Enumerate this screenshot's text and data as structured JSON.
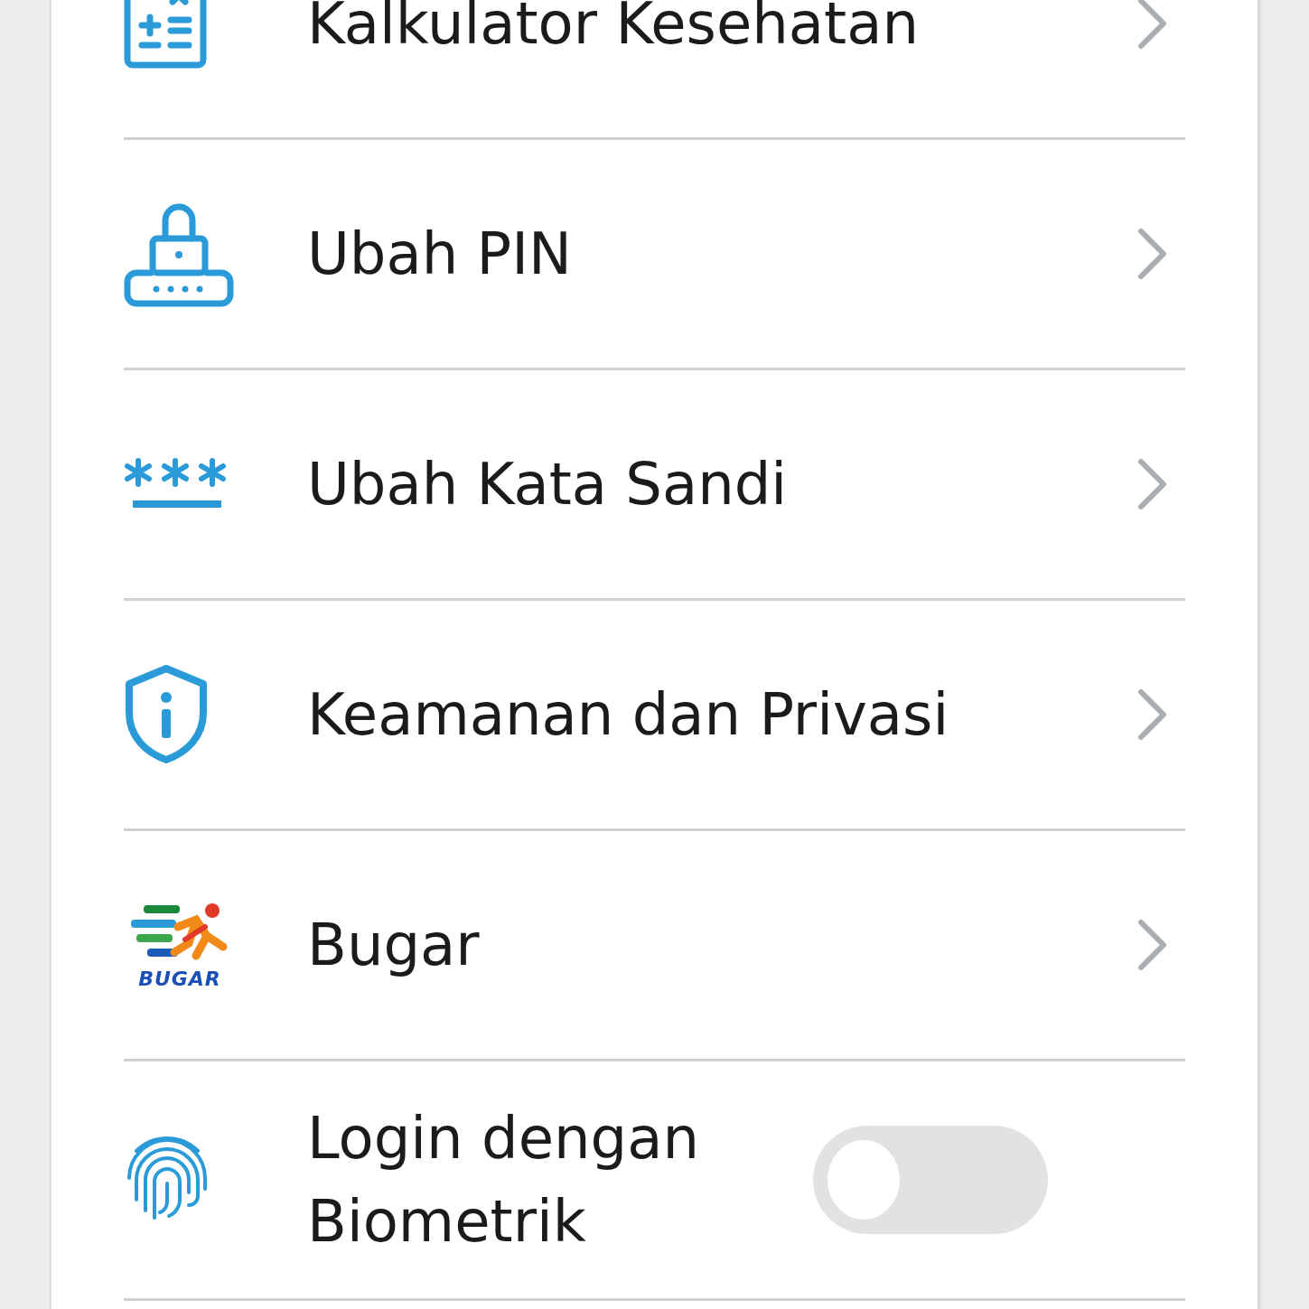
{
  "menu": [
    {
      "kind": "link",
      "label": "Kalkulator Kesehatan"
    },
    {
      "kind": "link",
      "label": "Ubah PIN"
    },
    {
      "kind": "link",
      "label": "Ubah Kata Sandi"
    },
    {
      "kind": "link",
      "label": "Keamanan dan Privasi"
    },
    {
      "kind": "link",
      "label": "Bugar",
      "logo_text": "BUGAR"
    },
    {
      "kind": "toggle",
      "label": "Login dengan Biometrik",
      "on": false
    }
  ]
}
